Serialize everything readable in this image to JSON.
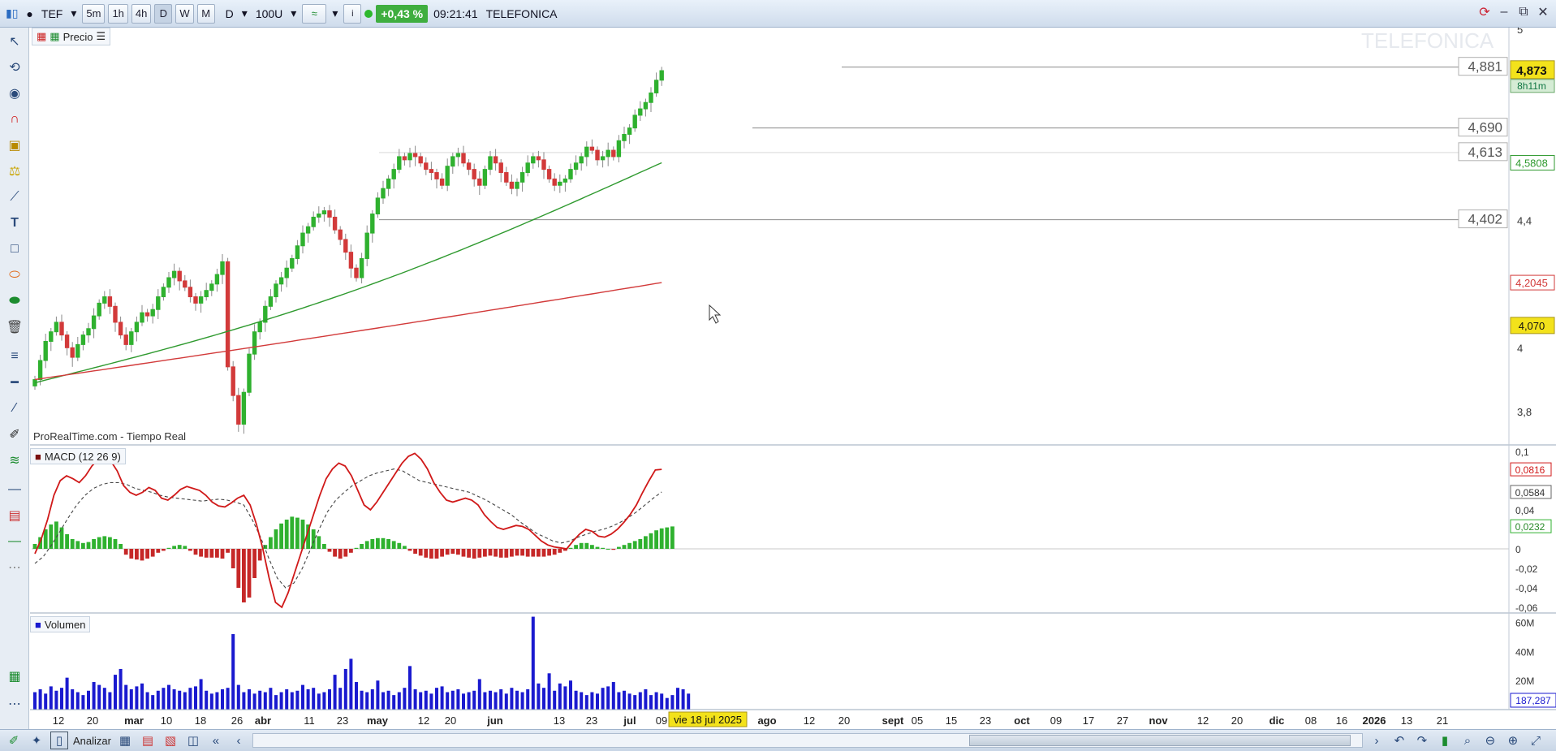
{
  "toolbar": {
    "symbol": "TEF",
    "timeframes": [
      "5m",
      "1h",
      "4h",
      "D",
      "W",
      "M"
    ],
    "period": "D",
    "units": "100U",
    "change": "+0,43 %",
    "time": "09:21:41",
    "name": "TELEFONICA"
  },
  "price_panel": {
    "label": "Precio",
    "watermark": "TELEFONICA",
    "source": "ProRealTime.com - Tiempo Real",
    "levels": [
      "4,881",
      "4,690",
      "4,613",
      "4,402"
    ],
    "axis_ticks": [
      "5",
      "4,4",
      "4",
      "3,8"
    ],
    "last_price": "4,873",
    "countdown": "8h11m",
    "ma_fast_value": "4,5808",
    "ma_slow_value": "4,2045",
    "marker_value": "4,070",
    "colors": {
      "up": "#2fb12f",
      "down": "#d23a3a",
      "ma_fast": "#2f9a2f",
      "ma_slow": "#d23a3a",
      "highlight": "#f3e21b"
    }
  },
  "macd_panel": {
    "label": "MACD (12 26 9)",
    "axis_ticks": [
      "0,1",
      "0,04",
      "0",
      "-0,02",
      "-0,04",
      "-0,06"
    ],
    "macd_value": "0,0816",
    "signal_value": "0,0584",
    "hist_value": "0,0232"
  },
  "volume_panel": {
    "label": "Volumen",
    "axis_ticks": [
      "60M",
      "40M",
      "20M"
    ],
    "last_value": "187,287",
    "color": "#1a1acf"
  },
  "time_axis": {
    "labels": [
      "12",
      "20",
      "mar",
      "10",
      "18",
      "26",
      "abr",
      "11",
      "23",
      "may",
      "12",
      "20",
      "jun",
      "13",
      "23",
      "jul",
      "09",
      "ago",
      "12",
      "20",
      "sept",
      "05",
      "15",
      "23",
      "oct",
      "09",
      "17",
      "27",
      "nov",
      "12",
      "20",
      "dic",
      "08",
      "16",
      "2026",
      "13",
      "21"
    ],
    "cursor_label": "vie 18 jul 2025"
  },
  "bottombar": {
    "analyze_label": "Analizar"
  },
  "chart_data": [
    {
      "type": "candlestick",
      "title": "TELEFONICA",
      "price_closes": [
        3.9,
        3.96,
        4.02,
        4.05,
        4.08,
        4.04,
        4.0,
        3.97,
        4.01,
        4.04,
        4.06,
        4.1,
        4.14,
        4.16,
        4.13,
        4.08,
        4.04,
        4.01,
        4.05,
        4.08,
        4.11,
        4.1,
        4.12,
        4.16,
        4.19,
        4.22,
        4.24,
        4.21,
        4.19,
        4.16,
        4.14,
        4.16,
        4.18,
        4.2,
        4.23,
        4.27,
        3.94,
        3.85,
        3.76,
        3.86,
        3.98,
        4.05,
        4.08,
        4.13,
        4.16,
        4.2,
        4.22,
        4.25,
        4.28,
        4.32,
        4.36,
        4.38,
        4.41,
        4.42,
        4.43,
        4.41,
        4.37,
        4.34,
        4.3,
        4.25,
        4.22,
        4.28,
        4.36,
        4.42,
        4.47,
        4.5,
        4.53,
        4.56,
        4.6,
        4.59,
        4.61,
        4.6,
        4.58,
        4.56,
        4.55,
        4.53,
        4.51,
        4.57,
        4.6,
        4.61,
        4.58,
        4.56,
        4.53,
        4.51,
        4.56,
        4.6,
        4.58,
        4.55,
        4.52,
        4.5,
        4.52,
        4.55,
        4.58,
        4.6,
        4.59,
        4.56,
        4.53,
        4.51,
        4.52,
        4.53,
        4.56,
        4.58,
        4.6,
        4.63,
        4.62,
        4.59,
        4.6,
        4.62,
        4.6,
        4.65,
        4.67,
        4.69,
        4.73,
        4.75,
        4.77,
        4.8,
        4.84,
        4.87
      ],
      "ma_fast_start": 3.89,
      "ma_fast_end": 4.5808,
      "ma_slow_start": 3.9,
      "ma_slow_end": 4.2045,
      "ylim": [
        3.7,
        5.0
      ]
    },
    {
      "type": "bar",
      "title": "MACD (12 26 9)",
      "histogram": [
        0.005,
        0.012,
        0.02,
        0.025,
        0.028,
        0.022,
        0.015,
        0.01,
        0.008,
        0.006,
        0.007,
        0.01,
        0.012,
        0.013,
        0.012,
        0.01,
        0.005,
        -0.006,
        -0.01,
        -0.011,
        -0.012,
        -0.01,
        -0.008,
        -0.004,
        -0.002,
        0.001,
        0.003,
        0.004,
        0.003,
        -0.002,
        -0.006,
        -0.008,
        -0.009,
        -0.009,
        -0.009,
        -0.01,
        -0.004,
        -0.02,
        -0.04,
        -0.055,
        -0.05,
        -0.03,
        -0.012,
        0.004,
        0.012,
        0.02,
        0.026,
        0.03,
        0.033,
        0.032,
        0.03,
        0.025,
        0.02,
        0.013,
        0.005,
        -0.003,
        -0.008,
        -0.01,
        -0.008,
        -0.004,
        0.001,
        0.005,
        0.008,
        0.01,
        0.011,
        0.011,
        0.01,
        0.008,
        0.006,
        0.003,
        -0.002,
        -0.005,
        -0.007,
        -0.009,
        -0.01,
        -0.01,
        -0.008,
        -0.006,
        -0.005,
        -0.006,
        -0.008,
        -0.009,
        -0.01,
        -0.009,
        -0.008,
        -0.007,
        -0.008,
        -0.009,
        -0.009,
        -0.008,
        -0.007,
        -0.007,
        -0.008,
        -0.008,
        -0.008,
        -0.008,
        -0.007,
        -0.006,
        -0.004,
        -0.002,
        0.001,
        0.004,
        0.006,
        0.006,
        0.004,
        0.002,
        0.001,
        0.0,
        -0.001,
        0.002,
        0.004,
        0.006,
        0.008,
        0.01,
        0.013,
        0.016,
        0.019,
        0.021,
        0.022,
        0.023
      ],
      "macd_line": [
        -0.005,
        0.01,
        0.03,
        0.055,
        0.07,
        0.075,
        0.072,
        0.068,
        0.075,
        0.085,
        0.092,
        0.095,
        0.09,
        0.08,
        0.065,
        0.058,
        0.055,
        0.058,
        0.063,
        0.06,
        0.052,
        0.05,
        0.055,
        0.061,
        0.064,
        0.062,
        0.06,
        0.055,
        0.048,
        0.044,
        0.043,
        0.047,
        0.052,
        0.055,
        0.045,
        0.025,
        0.0,
        -0.03,
        -0.055,
        -0.06,
        -0.045,
        -0.025,
        -0.005,
        0.015,
        0.035,
        0.055,
        0.072,
        0.082,
        0.088,
        0.085,
        0.075,
        0.06,
        0.045,
        0.04,
        0.048,
        0.058,
        0.068,
        0.078,
        0.088,
        0.095,
        0.098,
        0.092,
        0.082,
        0.068,
        0.058,
        0.05,
        0.048,
        0.05,
        0.052,
        0.05,
        0.045,
        0.035,
        0.028,
        0.022,
        0.02,
        0.022,
        0.024,
        0.023,
        0.02,
        0.014,
        0.008,
        0.004,
        0.002,
        0.001,
        0.0,
        0.008,
        0.015,
        0.02,
        0.018,
        0.013,
        0.012,
        0.015,
        0.02,
        0.027,
        0.035,
        0.045,
        0.058,
        0.07,
        0.081,
        0.0816
      ],
      "signal_line": [
        -0.015,
        -0.008,
        0.004,
        0.018,
        0.032,
        0.045,
        0.055,
        0.062,
        0.066,
        0.068,
        0.068,
        0.066,
        0.062,
        0.06,
        0.058,
        0.055,
        0.053,
        0.052,
        0.051,
        0.05,
        0.049,
        0.05,
        0.051,
        0.05,
        0.048,
        0.045,
        0.03,
        0.012,
        -0.01,
        -0.03,
        -0.04,
        -0.035,
        -0.02,
        0.0,
        0.02,
        0.038,
        0.05,
        0.058,
        0.065,
        0.07,
        0.075,
        0.078,
        0.08,
        0.082,
        0.08,
        0.075,
        0.07,
        0.068,
        0.066,
        0.064,
        0.062,
        0.06,
        0.058,
        0.054,
        0.05,
        0.045,
        0.04,
        0.035,
        0.028,
        0.022,
        0.016,
        0.012,
        0.008,
        0.006,
        0.008,
        0.012,
        0.015,
        0.018,
        0.02,
        0.023,
        0.027,
        0.032,
        0.038,
        0.045,
        0.052,
        0.0584
      ],
      "ylim": [
        -0.065,
        0.105
      ]
    },
    {
      "type": "bar",
      "title": "Volumen",
      "values": [
        12,
        14,
        11,
        16,
        13,
        15,
        22,
        14,
        12,
        10,
        13,
        19,
        17,
        15,
        12,
        24,
        28,
        17,
        14,
        16,
        18,
        12,
        10,
        13,
        15,
        17,
        14,
        13,
        12,
        15,
        16,
        21,
        13,
        11,
        12,
        14,
        15,
        52,
        17,
        12,
        14,
        11,
        13,
        12,
        15,
        10,
        12,
        14,
        12,
        13,
        17,
        14,
        15,
        11,
        12,
        14,
        24,
        15,
        28,
        35,
        19,
        13,
        12,
        14,
        20,
        12,
        13,
        10,
        12,
        15,
        30,
        14,
        12,
        13,
        11,
        15,
        16,
        12,
        13,
        14,
        11,
        12,
        13,
        21,
        12,
        13,
        12,
        14,
        11,
        15,
        13,
        12,
        14,
        64,
        18,
        15,
        25,
        13,
        18,
        16,
        20,
        13,
        12,
        10,
        12,
        11,
        15,
        16,
        19,
        12,
        13,
        11,
        10,
        12,
        14,
        10,
        12,
        11,
        8,
        10,
        15,
        14,
        11
      ],
      "ylim": [
        0,
        66
      ]
    }
  ]
}
